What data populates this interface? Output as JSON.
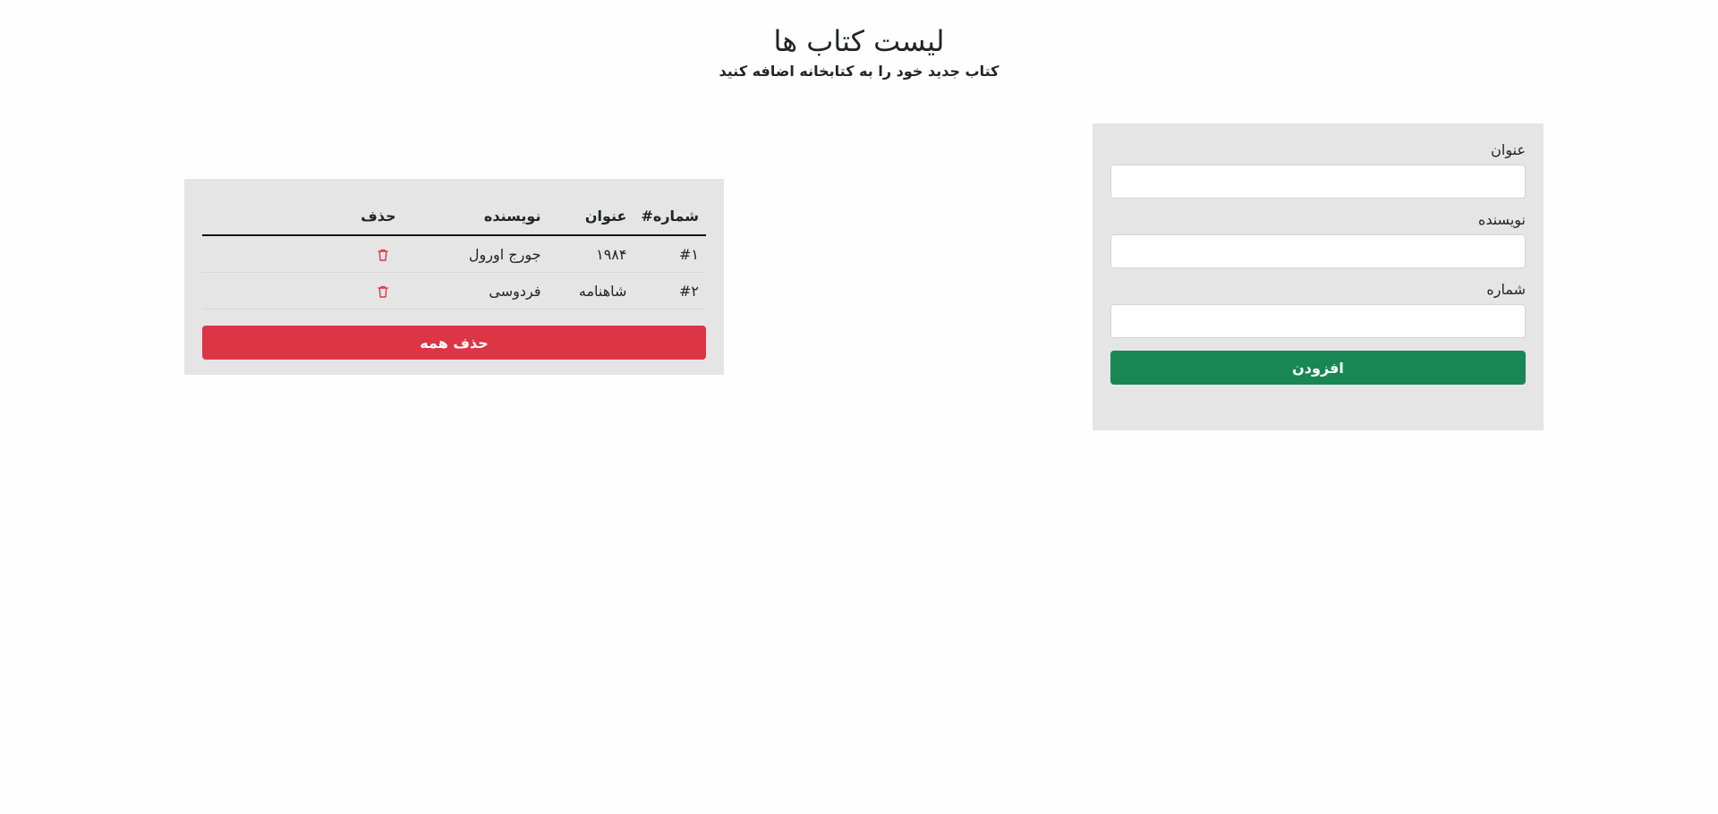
{
  "header": {
    "title": "لیست کتاب ها",
    "subtitle": "کتاب جدید خود را به کتابخانه اضافه کنید"
  },
  "form": {
    "title_label": "عنوان",
    "title_value": "",
    "author_label": "نویسنده",
    "author_value": "",
    "number_label": "شماره",
    "number_value": "",
    "add_button": "افزودن",
    "add_button_color": "#198754"
  },
  "table": {
    "headers": {
      "number": "شماره#",
      "title": "عنوان",
      "author": "نویسنده",
      "delete": "حذف"
    },
    "rows": [
      {
        "number": "#۱",
        "title": "۱۹۸۴",
        "author": "جورج اورول",
        "delete_icon": "trash-icon"
      },
      {
        "number": "#۲",
        "title": "شاهنامه",
        "author": "فردوسی",
        "delete_icon": "trash-icon"
      }
    ],
    "delete_all_button": "حذف همه",
    "delete_color": "#dc3545"
  }
}
